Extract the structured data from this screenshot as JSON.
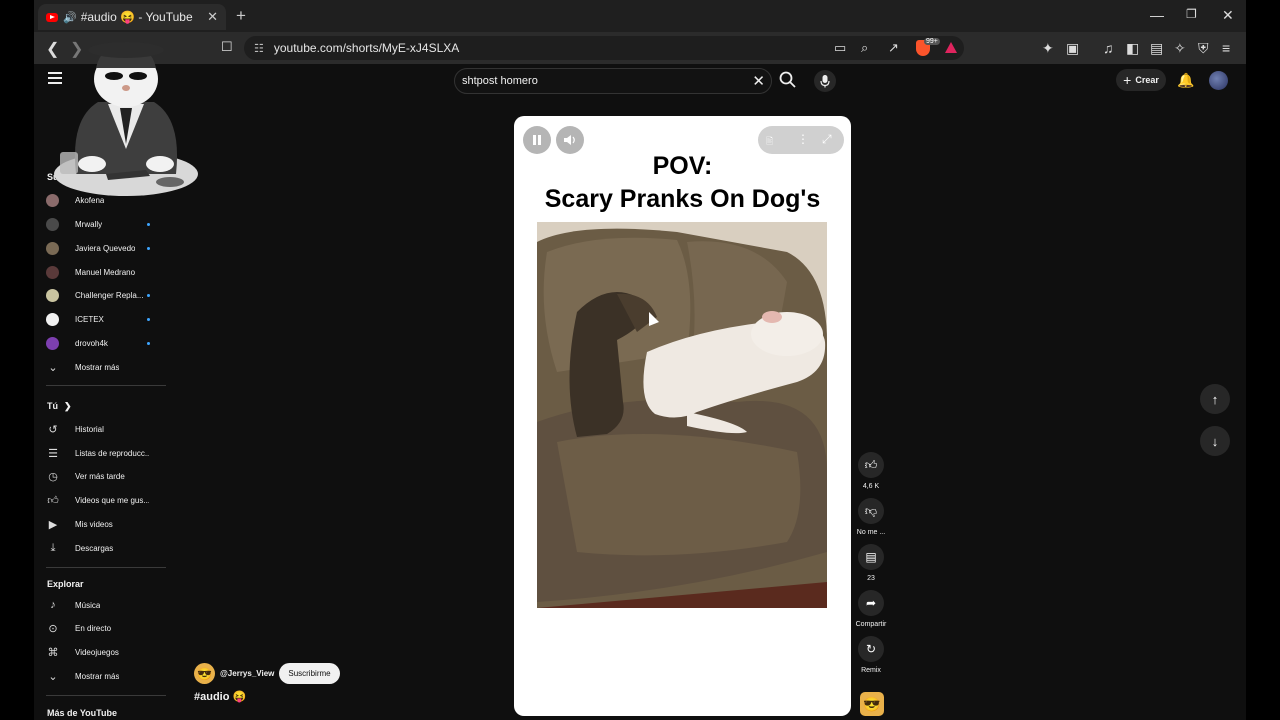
{
  "browser": {
    "tab_title": "#audio 😝 - YouTube",
    "speaker_glyph": "🔊",
    "close_glyph": "✕",
    "new_tab_glyph": "+",
    "url": "youtube.com/shorts/MyE-xJ4SLXA",
    "brave_badge": "99+",
    "window_controls": [
      "—",
      "❐",
      "✕"
    ]
  },
  "header": {
    "search_value": "shtpost homero",
    "search_clear": "✕",
    "create_label": "Crear"
  },
  "sidebar": {
    "subs_heading": "Su",
    "subscriptions": [
      {
        "name": "Akofena",
        "color": "#8a6b6b",
        "dot": false
      },
      {
        "name": "Mrwally",
        "color": "#4a4a4a",
        "dot": true
      },
      {
        "name": "Javiera Quevedo",
        "color": "#7a6a55",
        "dot": true
      },
      {
        "name": "Manuel Medrano",
        "color": "#5a3a3a",
        "dot": false
      },
      {
        "name": "Challenger Repla...",
        "color": "#c9c4a0",
        "dot": true
      },
      {
        "name": "ICETEX",
        "color": "#f1f1f1",
        "dot": true
      },
      {
        "name": "drovoh4k",
        "color": "#7d3fb0",
        "dot": true
      }
    ],
    "show_more_1": "Mostrar más",
    "you_heading": "Tú",
    "you_items": [
      {
        "label": "Historial",
        "icon": "history-icon"
      },
      {
        "label": "Listas de reproducc...",
        "icon": "playlist-icon"
      },
      {
        "label": "Ver más tarde",
        "icon": "clock-icon"
      },
      {
        "label": "Videos que me gus...",
        "icon": "thumb-up-icon"
      },
      {
        "label": "Mis videos",
        "icon": "my-videos-icon"
      },
      {
        "label": "Descargas",
        "icon": "download-icon"
      }
    ],
    "explore_heading": "Explorar",
    "explore_items": [
      {
        "label": "Música",
        "icon": "music-icon"
      },
      {
        "label": "En directo",
        "icon": "live-icon"
      },
      {
        "label": "Videojuegos",
        "icon": "gaming-icon"
      }
    ],
    "show_more_2": "Mostrar más",
    "more_heading": "Más de YouTube"
  },
  "short": {
    "title_line1": "POV:",
    "title_line2": "Scary Pranks On Dog's",
    "channel": "@Jerrys_View",
    "subscribe_label": "Suscribirme",
    "caption": "#audio 😝",
    "likes": "4,6 K",
    "dislike_label": "No me ...",
    "comments": "23",
    "share_label": "Compartir",
    "remix_label": "Remix"
  },
  "colors": {
    "background": "#0f0f0f",
    "youtube_red": "#ff0000",
    "subscribe_bg": "#f1f1f1",
    "new_dot": "#3ea6ff"
  }
}
